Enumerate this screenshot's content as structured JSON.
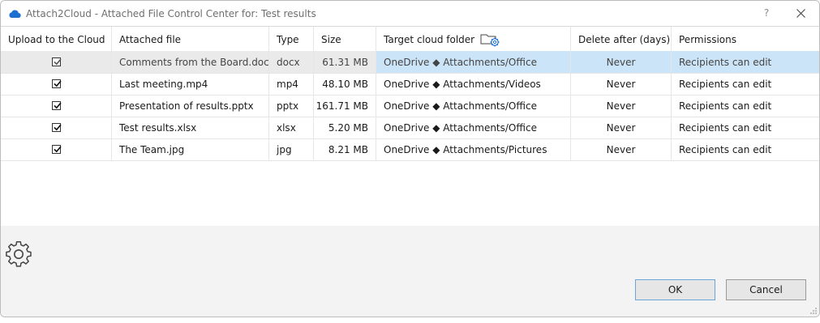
{
  "window": {
    "title": "Attach2Cloud - Attached File Control Center for: Test results",
    "help_label": "?"
  },
  "icons": {
    "app": "cloud-icon",
    "close": "close-icon",
    "folder_settings": "folder-gear-icon",
    "settings": "gear-icon",
    "resize": "resize-grip-icon"
  },
  "colors": {
    "selection": "#cce4f7",
    "cloud": "#1f6fd0"
  },
  "grid": {
    "columns": {
      "upload": "Upload to the Cloud",
      "file": "Attached file",
      "type": "Type",
      "size": "Size",
      "target": "Target cloud folder",
      "delete": "Delete after (days)",
      "permissions": "Permissions"
    },
    "rows": [
      {
        "upload": true,
        "file": "Comments from the Board.docx",
        "type": "docx",
        "size": "61.31 MB",
        "target": "OneDrive ◆ Attachments/Office",
        "delete": "Never",
        "permissions": "Recipients can edit",
        "selected": true
      },
      {
        "upload": true,
        "file": "Last meeting.mp4",
        "type": "mp4",
        "size": "48.10 MB",
        "target": "OneDrive ◆ Attachments/Videos",
        "delete": "Never",
        "permissions": "Recipients can edit",
        "selected": false
      },
      {
        "upload": true,
        "file": "Presentation of results.pptx",
        "type": "pptx",
        "size": "161.71 MB",
        "target": "OneDrive ◆ Attachments/Office",
        "delete": "Never",
        "permissions": "Recipients can edit",
        "selected": false
      },
      {
        "upload": true,
        "file": "Test results.xlsx",
        "type": "xlsx",
        "size": "5.20 MB",
        "target": "OneDrive ◆ Attachments/Office",
        "delete": "Never",
        "permissions": "Recipients can edit",
        "selected": false
      },
      {
        "upload": true,
        "file": "The Team.jpg",
        "type": "jpg",
        "size": "8.21 MB",
        "target": "OneDrive ◆ Attachments/Pictures",
        "delete": "Never",
        "permissions": "Recipients can edit",
        "selected": false
      }
    ]
  },
  "buttons": {
    "ok": "OK",
    "cancel": "Cancel"
  }
}
